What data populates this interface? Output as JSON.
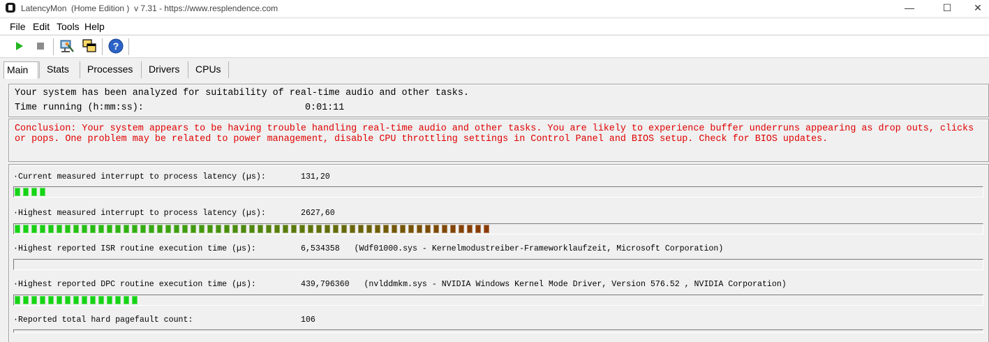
{
  "window": {
    "title": "LatencyMon  (Home Edition )  v 7.31 - https://www.resplendence.com",
    "minimize": "—",
    "maximize": "☐",
    "close": "✕"
  },
  "menu": [
    "File",
    "Edit",
    "Tools",
    "Help"
  ],
  "tabs": [
    "Main",
    "Stats",
    "Processes",
    "Drivers",
    "CPUs"
  ],
  "summary": {
    "analyzed_text": "Your system has been analyzed for suitability of real-time audio and other tasks.",
    "time_label": "Time running (h:mm:ss):",
    "time_value": "0:01:11"
  },
  "conclusion": "Conclusion: Your system appears to be having trouble handling real-time audio and other tasks. You are likely to experience buffer underruns appearing as drop outs, clicks or pops. One problem may be related to power management, disable CPU throttling settings in Control Panel and BIOS setup. Check for BIOS updates.",
  "metrics": [
    {
      "label": "·Current measured interrupt to process latency (µs):",
      "value": "131,20",
      "segments": 4,
      "fill_colors": "green"
    },
    {
      "label": "·Highest measured interrupt to process latency (µs):",
      "value": "2627,60",
      "segments": 57,
      "fill_colors": "green-to-brown"
    },
    {
      "label": "·Highest reported ISR routine execution time (µs):",
      "value": "6,534358   (Wdf01000.sys - Kernelmodustreiber-Frameworklaufzeit, Microsoft Corporation)",
      "segments": 0,
      "fill_colors": "green"
    },
    {
      "label": "·Highest reported DPC routine execution time (µs):",
      "value": "439,796360   (nvlddmkm.sys - NVIDIA Windows Kernel Mode Driver, Version 576.52 , NVIDIA Corporation)",
      "segments": 15,
      "fill_colors": "green"
    },
    {
      "label": "·Reported total hard pagefault count:",
      "value": "106",
      "segments": null,
      "fill_colors": "green"
    }
  ],
  "colors": {
    "conclusion_text": "#e00000",
    "bar_start": "#15d415",
    "bar_end": "#8a3a06"
  },
  "toolbar_icons": [
    "play-icon",
    "stop-icon",
    "settings-monitor-icon",
    "windows-icon",
    "help-icon"
  ]
}
